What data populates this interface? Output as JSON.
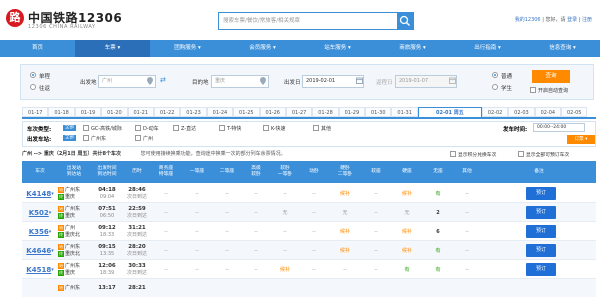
{
  "header": {
    "logo_mark": "路",
    "title": "中国铁路12306",
    "subtitle": "12306 CHINA RAILWAY",
    "search_placeholder": "搜索车票/餐饮/常旅客/相关规章",
    "my_account": "我的12306",
    "greeting": "您好，请",
    "login": "登录",
    "register": "注册"
  },
  "nav": [
    "首页",
    "车票 ▾",
    "团购服务 ▾",
    "会员服务 ▾",
    "站车服务 ▾",
    "商旅服务 ▾",
    "出行指南 ▾",
    "信息查询 ▾"
  ],
  "query": {
    "one_way": "单程",
    "round_trip": "往返",
    "from_label": "出发地",
    "from_value": "广州",
    "to_label": "目的地",
    "to_value": "重庆",
    "depart_label": "出发日",
    "depart_value": "2019-02-01",
    "return_label": "返程日",
    "return_value": "2019-01-07",
    "normal": "普通",
    "student": "学生",
    "search_button": "查询",
    "auto_query": "开启自动查询"
  },
  "dates": [
    "01-17",
    "01-18",
    "01-19",
    "01-20",
    "01-21",
    "01-22",
    "01-23",
    "01-24",
    "01-25",
    "01-26",
    "01-27",
    "01-28",
    "01-29",
    "01-30",
    "01-31",
    "02-01 周五",
    "02-02",
    "02-03",
    "02-04",
    "02-05"
  ],
  "active_date_index": 15,
  "filters": {
    "type_label": "车次类型:",
    "all": "全部",
    "types": [
      "GC-高铁/城际",
      "D-动车",
      "Z-直达",
      "T-特快",
      "K-快速",
      "其他"
    ],
    "from_station_label": "出发车站:",
    "from_stations": [
      "广州东",
      "广州"
    ],
    "time_label": "发车时间:",
    "time_value": "00:00--24:00",
    "sort": "订票 ▾"
  },
  "summary": {
    "route": "广州 --> 重庆（2月1日 周五）共计8个车次",
    "tip": "您可使用接续换乘功能，查询途中换乘一次的部分列车余票情况。",
    "show_all_label": "显示积分兑换车次",
    "show_all_seats": "显示全部可预订车次"
  },
  "columns": [
    "车次",
    "出发站\n到达站",
    "出发时间\n到达时间",
    "历时",
    "商务座\n特等座",
    "一等座",
    "二等座",
    "高级\n软卧",
    "软卧\n一等卧",
    "动卧",
    "硬卧\n二等卧",
    "软座",
    "硬座",
    "无座",
    "其他",
    "备注"
  ],
  "rows": [
    {
      "train": "K4148",
      "from": "广州东",
      "to": "重庆",
      "dep": "04:18",
      "arr": "09:04",
      "dur": "28:46",
      "day": "次日到达",
      "soft_sleeper": "--",
      "hard_sleeper": "候补",
      "soft_seat": "--",
      "hard_seat": "候补",
      "no_seat": "有",
      "book": "预订"
    },
    {
      "train": "K502",
      "from": "广州东",
      "to": "重庆",
      "dep": "07:51",
      "arr": "06:50",
      "dur": "22:59",
      "day": "次日到达",
      "soft_sleeper": "无",
      "hard_sleeper": "无",
      "soft_seat": "--",
      "hard_seat": "无",
      "no_seat": "2",
      "book": "预订"
    },
    {
      "train": "K356",
      "from": "广州",
      "to": "重庆北",
      "dep": "09:12",
      "arr": "18:33",
      "dur": "31:21",
      "day": "次日到达",
      "soft_sleeper": "--",
      "hard_sleeper": "候补",
      "soft_seat": "--",
      "hard_seat": "候补",
      "no_seat": "6",
      "book": "预订"
    },
    {
      "train": "K4646",
      "from": "广州东",
      "to": "重庆北",
      "dep": "09:15",
      "arr": "13:35",
      "dur": "28:20",
      "day": "次日到达",
      "soft_sleeper": "--",
      "hard_sleeper": "候补",
      "soft_seat": "--",
      "hard_seat": "候补",
      "no_seat": "有",
      "book": "预订"
    },
    {
      "train": "K4518",
      "from": "广州东",
      "to": "重庆",
      "dep": "12:06",
      "arr": "18:39",
      "dur": "30:33",
      "day": "次日到达",
      "soft_sleeper": "候补",
      "hard_sleeper": "--",
      "soft_seat": "--",
      "hard_seat": "有",
      "no_seat": "有",
      "book": "预订"
    },
    {
      "train": "",
      "from": "广州东",
      "to": "",
      "dep": "13:17",
      "arr": "",
      "dur": "28:21",
      "day": "",
      "soft_sleeper": "",
      "hard_sleeper": "",
      "soft_seat": "",
      "hard_seat": "",
      "no_seat": "",
      "book": ""
    }
  ],
  "colors": {
    "brand_blue": "#3b8fd9",
    "accent_orange": "#ff8a00",
    "logo_red": "#d71920",
    "book_blue": "#1f6fd6",
    "available_green": "#26a306"
  }
}
